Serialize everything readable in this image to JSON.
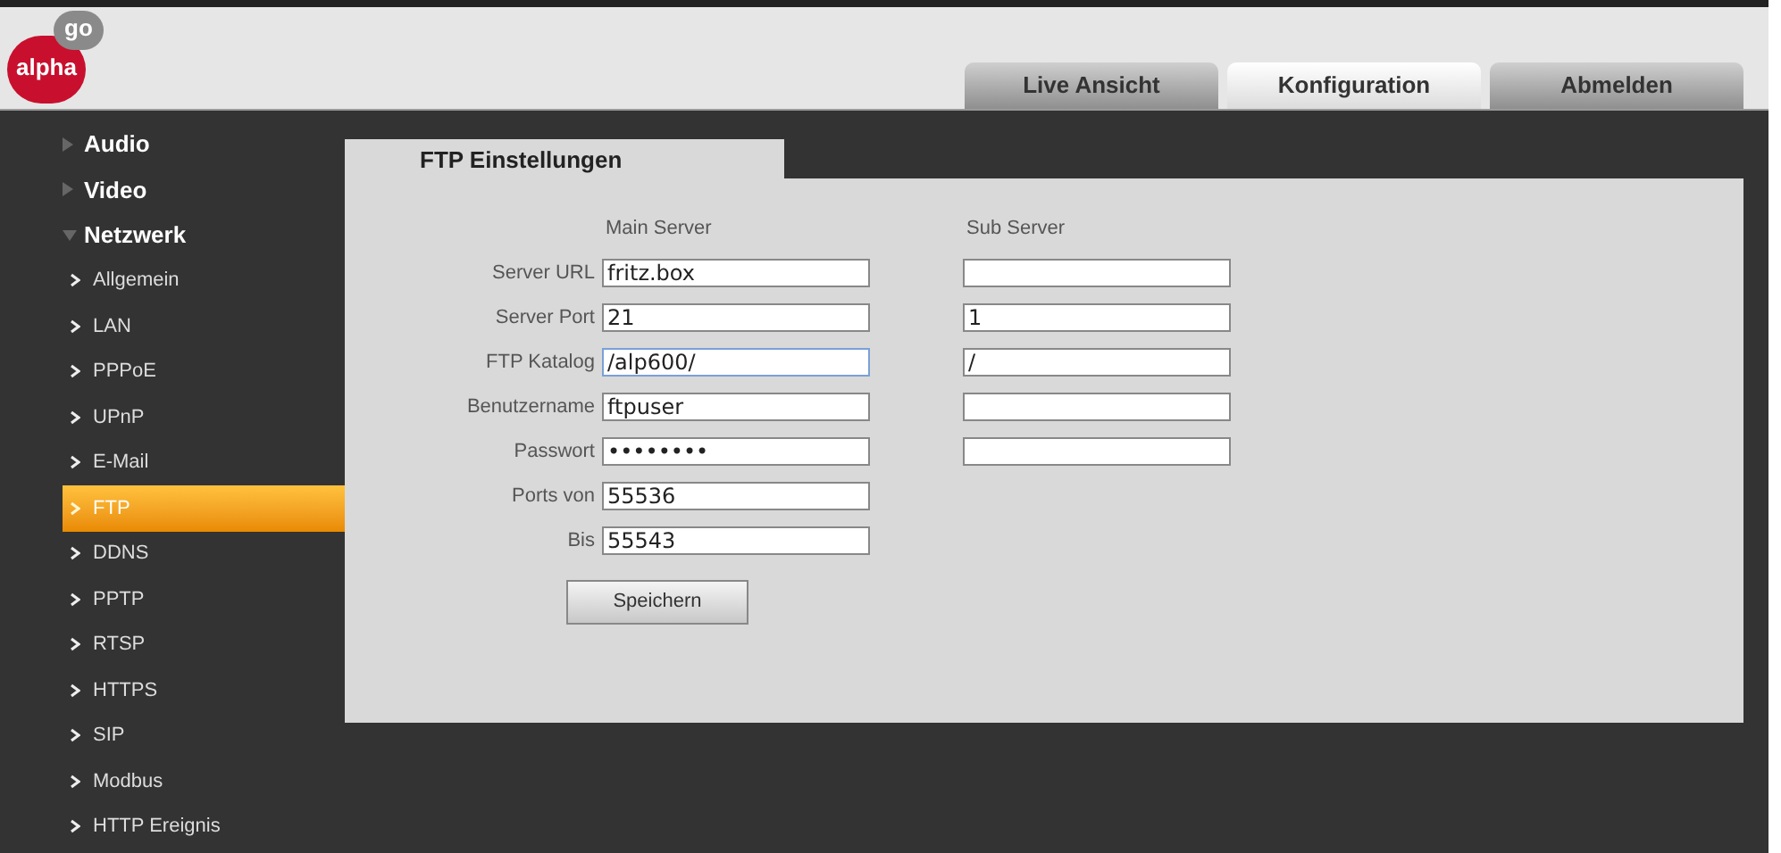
{
  "logo": {
    "main": "alpha",
    "accent": "go"
  },
  "nav_tabs": [
    {
      "label": "Live Ansicht",
      "selected": false
    },
    {
      "label": "Konfiguration",
      "selected": true
    },
    {
      "label": "Abmelden",
      "selected": false
    }
  ],
  "sidebar": {
    "items": [
      {
        "kind": "group",
        "label": "Audio",
        "expanded": false,
        "selected": false
      },
      {
        "kind": "group",
        "label": "Video",
        "expanded": false,
        "selected": false
      },
      {
        "kind": "group",
        "label": "Netzwerk",
        "expanded": true,
        "selected": false
      },
      {
        "kind": "item",
        "label": "Allgemein",
        "selected": false
      },
      {
        "kind": "item",
        "label": "LAN",
        "selected": false
      },
      {
        "kind": "item",
        "label": "PPPoE",
        "selected": false
      },
      {
        "kind": "item",
        "label": "UPnP",
        "selected": false
      },
      {
        "kind": "item",
        "label": "E-Mail",
        "selected": false
      },
      {
        "kind": "item",
        "label": "FTP",
        "selected": true
      },
      {
        "kind": "item",
        "label": "DDNS",
        "selected": false
      },
      {
        "kind": "item",
        "label": "PPTP",
        "selected": false
      },
      {
        "kind": "item",
        "label": "RTSP",
        "selected": false
      },
      {
        "kind": "item",
        "label": "HTTPS",
        "selected": false
      },
      {
        "kind": "item",
        "label": "SIP",
        "selected": false
      },
      {
        "kind": "item",
        "label": "Modbus",
        "selected": false
      },
      {
        "kind": "item",
        "label": "HTTP Ereignis",
        "selected": false
      }
    ]
  },
  "panel": {
    "title": "FTP Einstellungen",
    "columns": [
      "Main Server",
      "Sub Server"
    ],
    "rows": [
      {
        "label": "Server URL",
        "main": {
          "value": "fritz.box",
          "focused": false
        },
        "sub": {
          "focused": false
        }
      },
      {
        "label": "Server Port",
        "main": {
          "value": "21",
          "focused": false
        },
        "sub": {
          "value": "1",
          "focused": false
        }
      },
      {
        "label": "FTP Katalog",
        "main": {
          "value": "/alp600/",
          "focused": true
        },
        "sub": {
          "value": "/",
          "focused": false
        }
      },
      {
        "label": "Benutzername",
        "main": {
          "value": "ftpuser",
          "focused": false
        },
        "sub": {
          "focused": false
        }
      },
      {
        "label": "Passwort",
        "main": {
          "value": "••••••••",
          "focused": false
        },
        "sub": {
          "focused": false
        }
      },
      {
        "label": "Ports von",
        "main": {
          "value": "55536",
          "focused": false
        }
      },
      {
        "label": "Bis",
        "main": {
          "value": "55543",
          "focused": false
        }
      }
    ],
    "save_button": "Speichern"
  }
}
